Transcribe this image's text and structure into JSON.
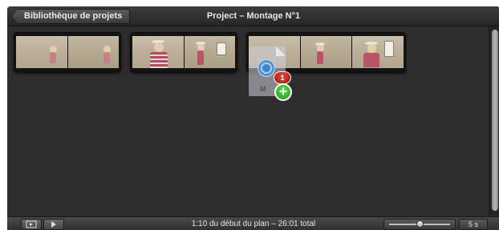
{
  "header": {
    "back_label": "Bibliothèque de projets",
    "title": "Project – Montage N°1"
  },
  "clips": [
    {
      "frames": 2
    },
    {
      "frames": 2
    },
    {
      "frames": 3
    }
  ],
  "drag": {
    "ghost_label": "M",
    "count_badge": "1",
    "plus_symbol": "+"
  },
  "footer": {
    "play_full_icon": "play-full-icon",
    "play_icon": "play-icon",
    "status": "1:10 du début du plan – 26:01 total",
    "zoom_value": "5 s"
  },
  "colors": {
    "background": "#2d2d2d",
    "badge_red": "#c0281a",
    "badge_green": "#2fb51f"
  }
}
